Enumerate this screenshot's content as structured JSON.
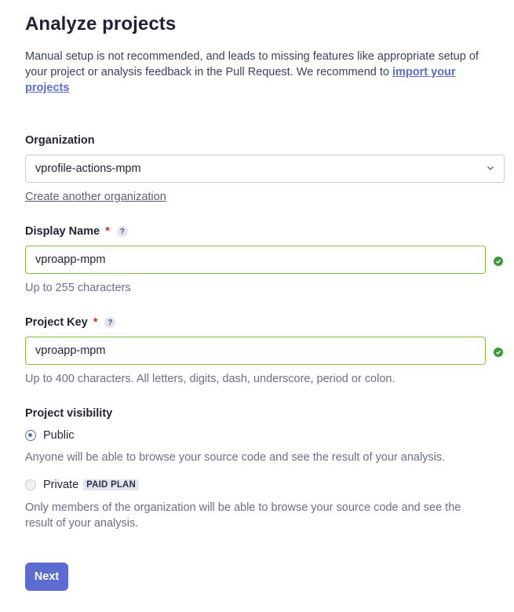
{
  "page": {
    "title": "Analyze projects",
    "intro_text": "Manual setup is not recommended, and leads to missing features like appropriate setup of your project or analysis feedback in the Pull Request. We recommend to ",
    "intro_link": "import your projects"
  },
  "organization": {
    "label": "Organization",
    "selected": "vprofile-actions-mpm",
    "create_link": "Create another organization"
  },
  "display_name": {
    "label": "Display Name",
    "required_mark": "*",
    "help": "?",
    "value": "vproapp-mpm",
    "hint": "Up to 255 characters"
  },
  "project_key": {
    "label": "Project Key",
    "required_mark": "*",
    "help": "?",
    "value": "vproapp-mpm",
    "hint": "Up to 400 characters. All letters, digits, dash, underscore, period or colon."
  },
  "visibility": {
    "label": "Project visibility",
    "public_label": "Public",
    "public_desc": "Anyone will be able to browse your source code and see the result of your analysis.",
    "private_label": "Private",
    "private_badge": "PAID PLAN",
    "private_desc": "Only members of the organization will be able to browse your source code and see the result of your analysis.",
    "selected": "public"
  },
  "actions": {
    "next_label": "Next"
  },
  "colors": {
    "accent": "#5d6cd0",
    "valid_border": "#84bf3b",
    "valid_icon": "#3d9a3a",
    "required": "#d02b2b"
  }
}
